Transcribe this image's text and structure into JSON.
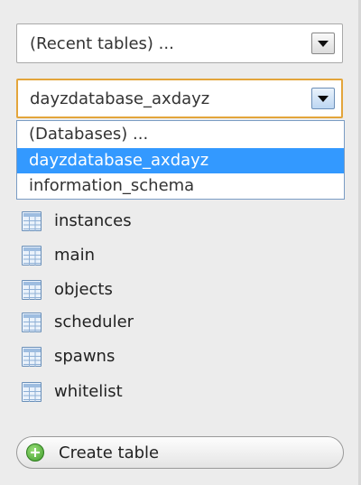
{
  "recent_select": {
    "value": "(Recent tables) ...",
    "icon": "chevron-down-icon"
  },
  "database_select": {
    "value": "dayzdatabase_axdayz",
    "icon": "chevron-down-icon",
    "focus_color": "#e3a53b",
    "options": [
      {
        "label": "(Databases) ...",
        "selected": false
      },
      {
        "label": "dayzdatabase_axdayz",
        "selected": true
      },
      {
        "label": "information_schema",
        "selected": false
      }
    ],
    "highlight_color": "#3399ff"
  },
  "tables": [
    {
      "name": "instances",
      "icon": "table-icon"
    },
    {
      "name": "main",
      "icon": "table-icon"
    },
    {
      "name": "objects",
      "icon": "table-icon"
    },
    {
      "name": "scheduler",
      "icon": "table-icon"
    },
    {
      "name": "spawns",
      "icon": "table-icon"
    },
    {
      "name": "whitelist",
      "icon": "table-icon"
    }
  ],
  "create_table": {
    "label": "Create table",
    "icon": "plus-circle-icon",
    "icon_color": "#3e9b2a"
  }
}
